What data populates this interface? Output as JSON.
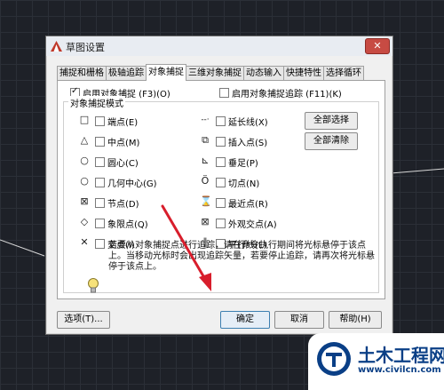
{
  "window": {
    "title": "草图设置",
    "close_label": "✕"
  },
  "tabs": [
    {
      "label": "捕捉和栅格",
      "active": false
    },
    {
      "label": "极轴追踪",
      "active": false
    },
    {
      "label": "对象捕捉",
      "active": true
    },
    {
      "label": "三维对象捕捉",
      "active": false
    },
    {
      "label": "动态输入",
      "active": false
    },
    {
      "label": "快捷特性",
      "active": false
    },
    {
      "label": "选择循环",
      "active": false
    }
  ],
  "enable_snap": {
    "label": "启用对象捕捉 (F3)(O)",
    "checked": true
  },
  "enable_tracking": {
    "label": "启用对象捕捉追踪 (F11)(K)",
    "checked": false
  },
  "mode_group_title": "对象捕捉模式",
  "left_modes": [
    {
      "symbol": "□",
      "label": "端点(E)",
      "checked": false
    },
    {
      "symbol": "△",
      "label": "中点(M)",
      "checked": false
    },
    {
      "symbol": "○",
      "label": "圆心(C)",
      "checked": false
    },
    {
      "symbol": "○",
      "label": "几何中心(G)",
      "checked": false
    },
    {
      "symbol": "⊠",
      "label": "节点(D)",
      "checked": false
    },
    {
      "symbol": "◇",
      "label": "象限点(Q)",
      "checked": false
    },
    {
      "symbol": "✕",
      "label": "交点(I)",
      "checked": false
    }
  ],
  "right_modes": [
    {
      "symbol": "--·",
      "label": "延长线(X)",
      "checked": false
    },
    {
      "symbol": "⧉",
      "label": "插入点(S)",
      "checked": false
    },
    {
      "symbol": "⊾",
      "label": "垂足(P)",
      "checked": false
    },
    {
      "symbol": "Ö",
      "label": "切点(N)",
      "checked": false
    },
    {
      "symbol": "⌛",
      "label": "最近点(R)",
      "checked": false
    },
    {
      "symbol": "⊠",
      "label": "外观交点(A)",
      "checked": false
    },
    {
      "symbol": "∥",
      "label": "平行线(L)",
      "checked": false
    }
  ],
  "select_all_label": "全部选择",
  "clear_all_label": "全部清除",
  "info_text": "若要从对象捕捉点进行追踪，请在命令执行期间将光标悬停于该点上。当移动光标时会出现追踪矢量，若要停止追踪，请再次将光标悬停于该点上。",
  "buttons": {
    "options": "选项(T)...",
    "ok": "确定",
    "cancel": "取消",
    "help": "帮助(H)"
  },
  "watermark": {
    "name": "土木工程网",
    "url": "www.civilcn.com"
  },
  "colors": {
    "accent": "#c0392b",
    "arrow": "#d81e2c",
    "brand": "#0a3f86"
  }
}
